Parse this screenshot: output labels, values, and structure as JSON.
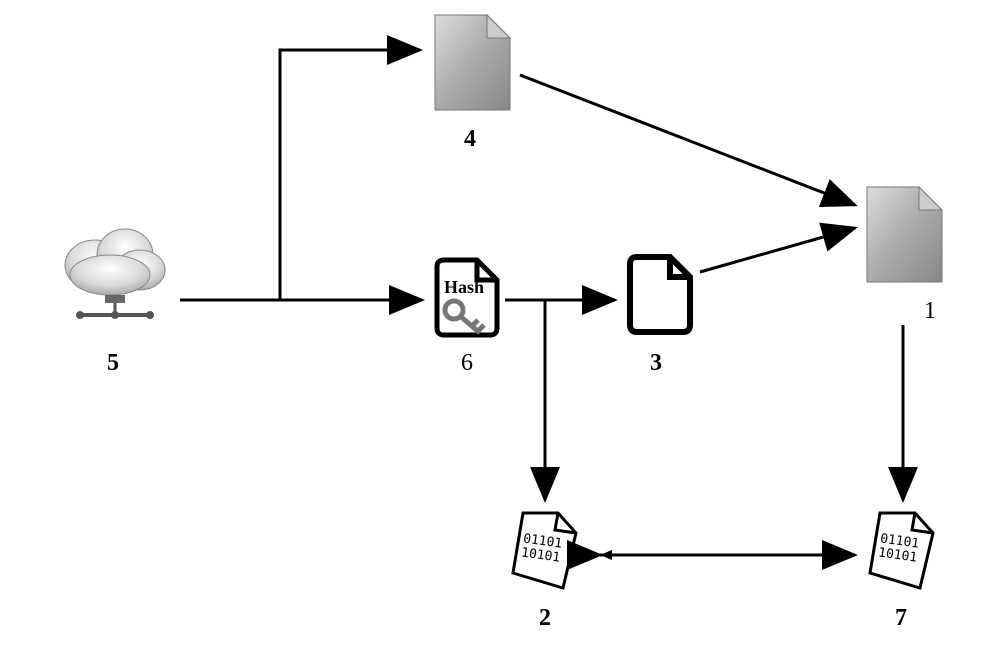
{
  "diagram": {
    "nodes": {
      "cloud": {
        "id": "5",
        "label": "5"
      },
      "file_top": {
        "id": "4",
        "label": "4"
      },
      "hash_key": {
        "id": "6",
        "label": "6",
        "text": "Hash"
      },
      "file_empty": {
        "id": "3",
        "label": "3"
      },
      "file_right": {
        "id": "1",
        "label": "1"
      },
      "binary_left": {
        "id": "2",
        "label": "2",
        "text_top": "01101",
        "text_bot": "10101"
      },
      "binary_right": {
        "id": "7",
        "label": "7",
        "text_top": "01101",
        "text_bot": "10101"
      }
    },
    "edges": [
      {
        "from": "5",
        "to": "4"
      },
      {
        "from": "5",
        "to": "6"
      },
      {
        "from": "4",
        "to": "1"
      },
      {
        "from": "6",
        "to": "3"
      },
      {
        "from": "3",
        "to": "1"
      },
      {
        "from": "6",
        "to": "2"
      },
      {
        "from": "1",
        "to": "7"
      },
      {
        "from": "2",
        "to": "7",
        "bidirectional": true
      }
    ]
  }
}
